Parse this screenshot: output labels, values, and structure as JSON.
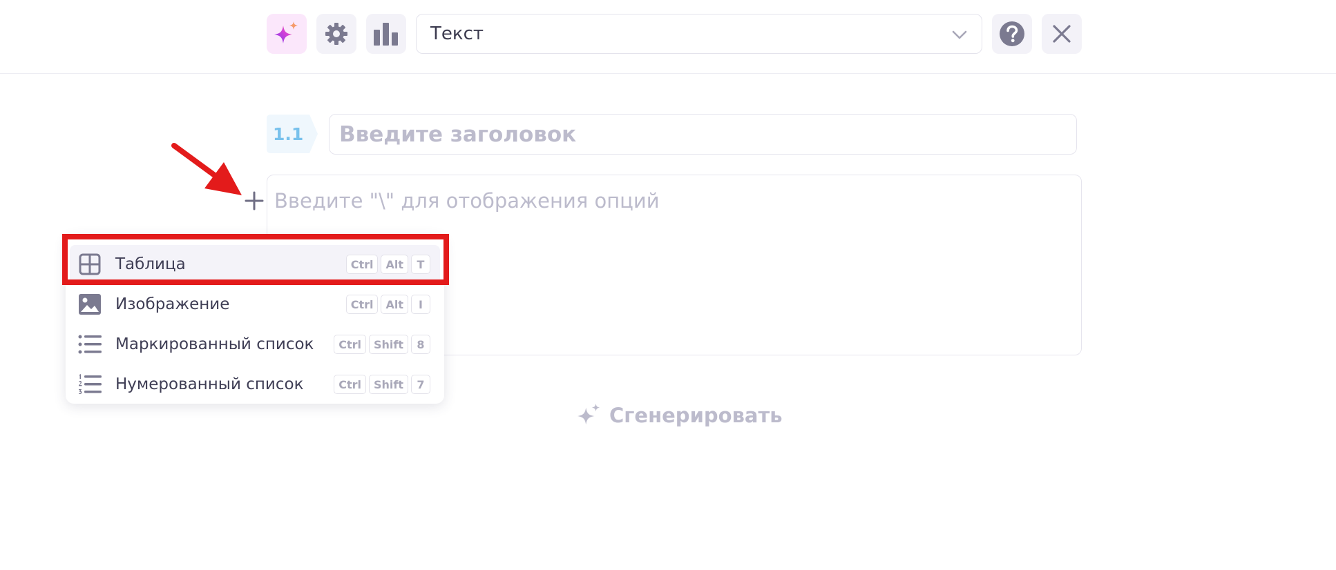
{
  "toolbar": {
    "ai_button_icon": "sparkle-icon",
    "settings_icon": "gear-icon",
    "stats_icon": "bar-chart-icon",
    "type_select_value": "Текст",
    "help_icon": "question-icon",
    "close_icon": "close-icon"
  },
  "editor": {
    "section_number": "1.1",
    "title_placeholder": "Введите заголовок",
    "body_placeholder": "Введите \"\\\" для отображения опций",
    "generate_label": "Сгенерировать"
  },
  "menu": {
    "items": [
      {
        "label": "Таблица",
        "icon": "table-icon",
        "keys": [
          "Ctrl",
          "Alt",
          "T"
        ]
      },
      {
        "label": "Изображение",
        "icon": "image-icon",
        "keys": [
          "Ctrl",
          "Alt",
          "I"
        ]
      },
      {
        "label": "Маркированный список",
        "icon": "bulleted-list-icon",
        "keys": [
          "Ctrl",
          "Shift",
          "8"
        ]
      },
      {
        "label": "Нумерованный список",
        "icon": "numbered-list-icon",
        "keys": [
          "Ctrl",
          "Shift",
          "7"
        ]
      }
    ]
  },
  "colors": {
    "accent_red": "#e31b1b",
    "section_blue": "#78c1ec",
    "placeholder_gray": "#bcbbcc",
    "icon_gray": "#7b7a90"
  }
}
